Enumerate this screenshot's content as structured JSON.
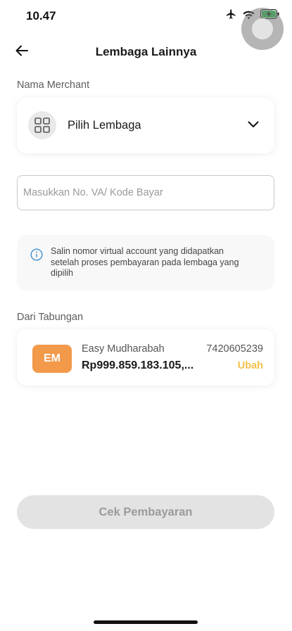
{
  "status_bar": {
    "time": "10.47",
    "icons": [
      "airplane-icon",
      "wifi-icon",
      "battery-charging-icon"
    ],
    "battery_color": "#34c759"
  },
  "header": {
    "title": "Lembaga Lainnya",
    "back_icon": "arrow-left-icon"
  },
  "merchant": {
    "label": "Nama Merchant",
    "select_text": "Pilih Lembaga",
    "icon": "grid-icon"
  },
  "payment_code": {
    "placeholder": "Masukkan No. VA/ Kode Bayar",
    "value": ""
  },
  "info": {
    "icon": "info-icon",
    "text": "Salin nomor virtual account yang didapatkan setelah proses pembayaran pada lembaga yang dipilih"
  },
  "source_account": {
    "label": "Dari Tabungan",
    "badge": "EM",
    "name": "Easy Mudharabah",
    "number": "7420605239",
    "balance": "Rp999.859.183.105,...",
    "change_label": "Ubah"
  },
  "actions": {
    "check_payment_label": "Cek Pembayaran"
  },
  "colors": {
    "accent_orange": "#f2994a",
    "link_yellow": "#f2c14a",
    "info_blue": "#3d8fd1",
    "disabled_button": "#e3e3e3"
  }
}
